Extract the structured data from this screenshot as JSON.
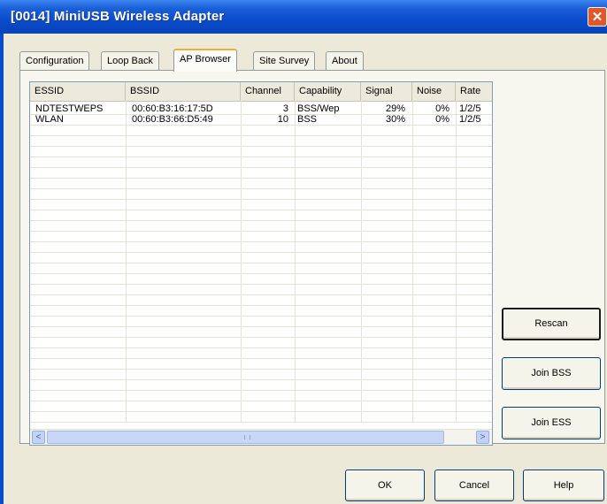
{
  "window": {
    "title": "[0014] MiniUSB Wireless Adapter",
    "close_glyph": "✕",
    "accent_color": "#0a4ccc"
  },
  "tabs": [
    {
      "label": "Configuration",
      "active": false
    },
    {
      "label": "Loop Back",
      "active": false
    },
    {
      "label": "AP Browser",
      "active": true
    },
    {
      "label": "Site Survey",
      "active": false
    },
    {
      "label": "About",
      "active": false
    }
  ],
  "list": {
    "columns": [
      "ESSID",
      "BSSID",
      "Channel",
      "Capability",
      "Signal",
      "Noise",
      "Rate"
    ],
    "rows": [
      {
        "essid": "NDTESTWEPS",
        "bssid": "00:60:B3:16:17:5D",
        "channel": "3",
        "capability": "BSS/Wep",
        "signal": "29%",
        "noise": "0%",
        "rate": "1/2/5"
      },
      {
        "essid": "WLAN",
        "bssid": "00:60:B3:66:D5:49",
        "channel": "10",
        "capability": "BSS",
        "signal": "30%",
        "noise": "0%",
        "rate": "1/2/5"
      }
    ],
    "scroll_left_glyph": "<",
    "scroll_right_glyph": ">"
  },
  "side_buttons": {
    "rescan": "Rescan",
    "join_bss": "Join BSS",
    "join_ess": "Join ESS"
  },
  "footer_buttons": {
    "ok": "OK",
    "cancel": "Cancel",
    "help": "Help"
  }
}
